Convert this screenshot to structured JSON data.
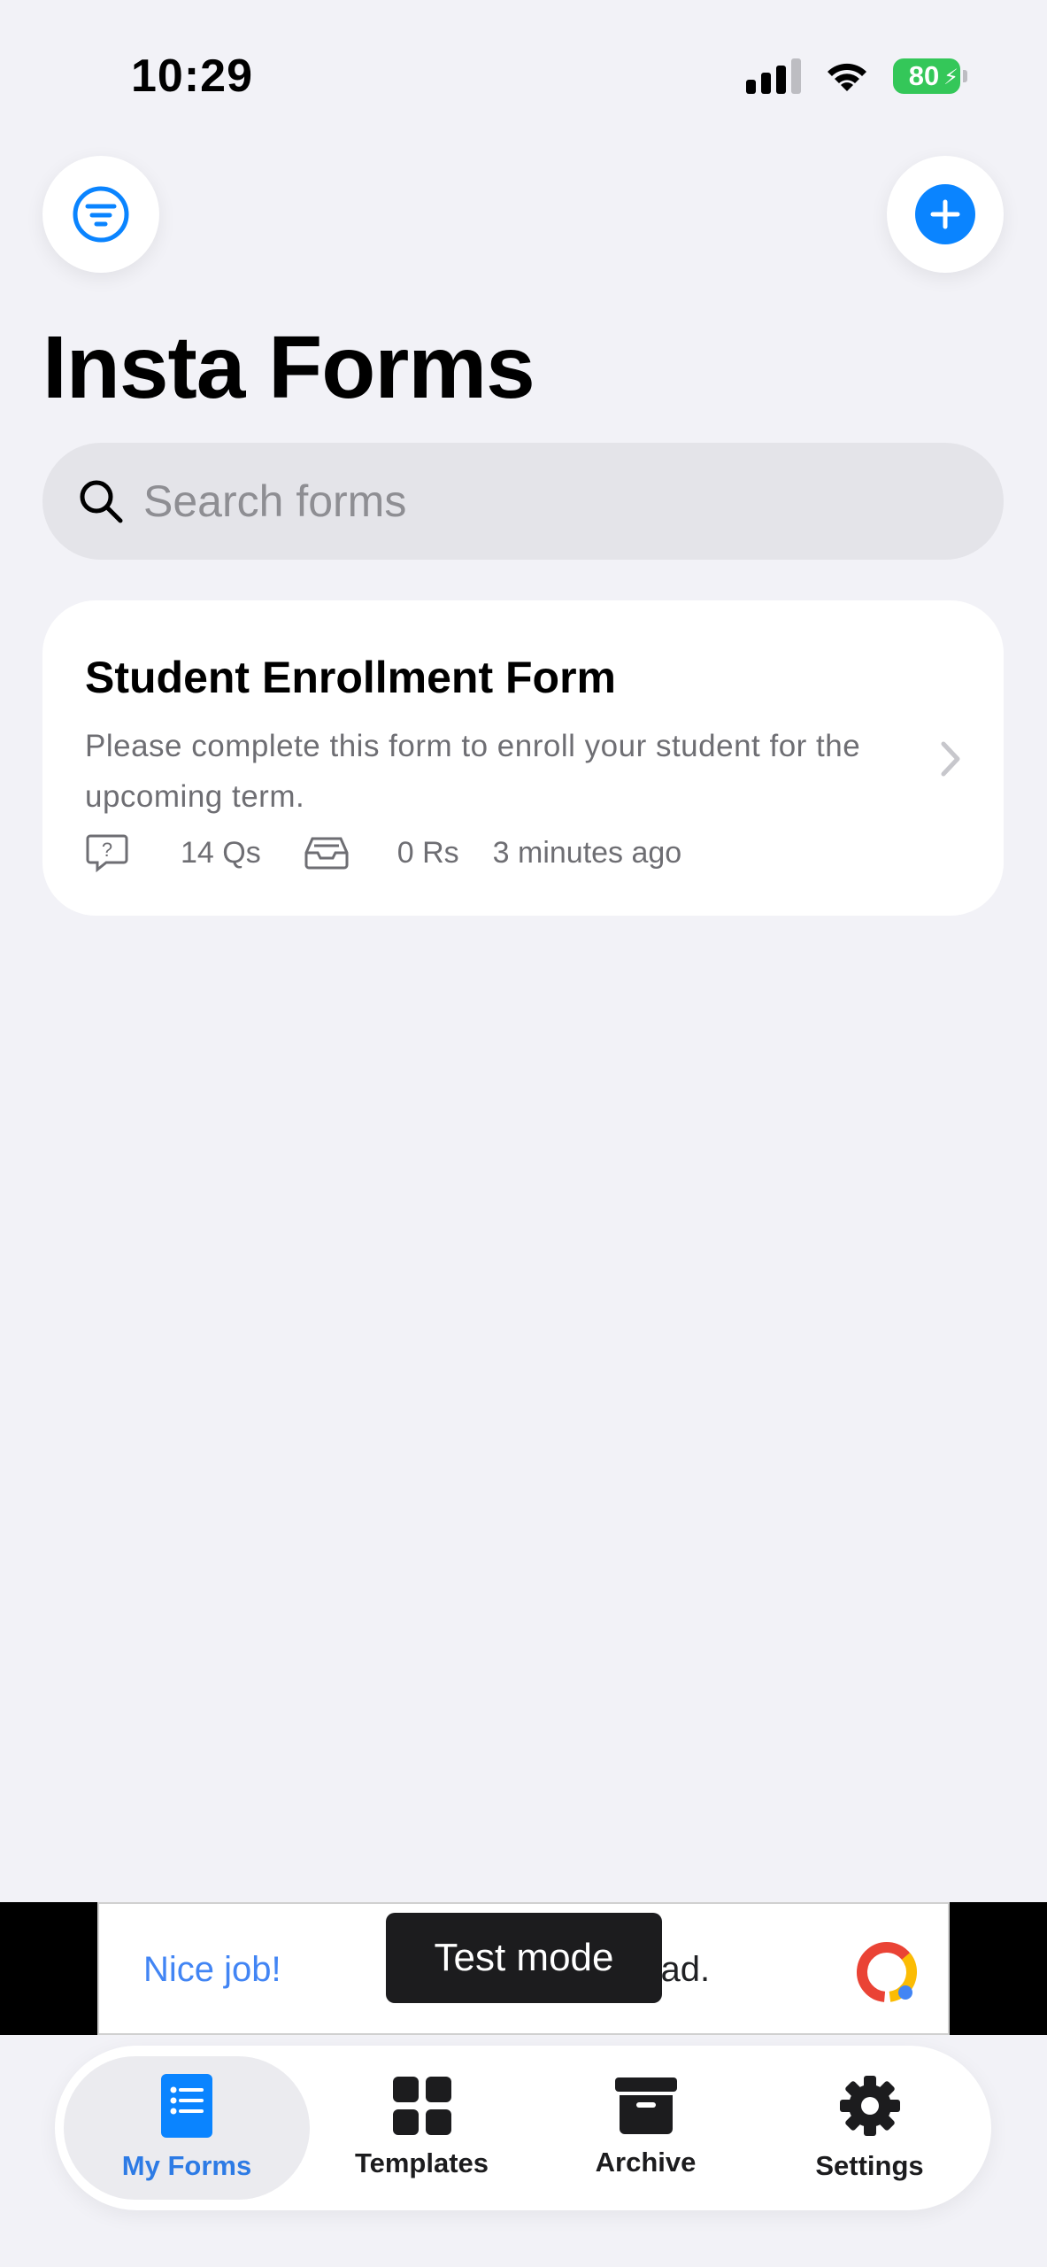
{
  "status_bar": {
    "time": "10:29",
    "battery": "80"
  },
  "header": {
    "title": "Insta Forms"
  },
  "search": {
    "placeholder": "Search forms"
  },
  "forms": [
    {
      "title": "Student Enrollment Form",
      "description": "Please complete this form to enroll your student for the upcoming term.",
      "questions": "14 Qs",
      "responses": "0 Rs",
      "updated": "3 minutes ago"
    }
  ],
  "ad": {
    "headline": "Nice job!",
    "body": "est ad.",
    "toast": "Test mode"
  },
  "tabs": [
    {
      "label": "My Forms"
    },
    {
      "label": "Templates"
    },
    {
      "label": "Archive"
    },
    {
      "label": "Settings"
    }
  ],
  "colors": {
    "accent": "#0a84ff",
    "active_tab": "#2d7be5",
    "battery": "#34c759",
    "background": "#f2f2f7"
  }
}
